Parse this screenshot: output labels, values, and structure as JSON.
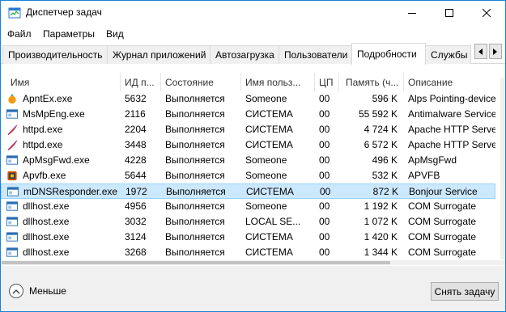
{
  "window": {
    "title": "Диспетчер задач"
  },
  "menu": [
    {
      "label": "Файл"
    },
    {
      "label": "Параметры"
    },
    {
      "label": "Вид"
    }
  ],
  "tabs": [
    {
      "label": "Производительность"
    },
    {
      "label": "Журнал приложений"
    },
    {
      "label": "Автозагрузка"
    },
    {
      "label": "Пользователи"
    },
    {
      "label": "Подробности",
      "active": true
    },
    {
      "label": "Службы"
    }
  ],
  "columns": [
    "Имя",
    "ИД п...",
    "Состояние",
    "Имя польз...",
    "ЦП",
    "Память (ч...",
    "Описание"
  ],
  "rows": [
    {
      "name": "ApntEx.exe",
      "pid": "5632",
      "status": "Выполняется",
      "user": "Someone",
      "cpu": "00",
      "memory": "596 K",
      "description": "Alps Pointing-device",
      "icon": "alps-icon"
    },
    {
      "name": "MsMpEng.exe",
      "pid": "2116",
      "status": "Выполняется",
      "user": "СИСТЕМА",
      "cpu": "00",
      "memory": "55 592 K",
      "description": "Antimalware Service",
      "icon": "service-window-icon"
    },
    {
      "name": "httpd.exe",
      "pid": "2204",
      "status": "Выполняется",
      "user": "СИСТЕМА",
      "cpu": "00",
      "memory": "4 724 K",
      "description": "Apache HTTP Serve",
      "icon": "apache-feather-icon"
    },
    {
      "name": "httpd.exe",
      "pid": "3448",
      "status": "Выполняется",
      "user": "СИСТЕМА",
      "cpu": "00",
      "memory": "6 572 K",
      "description": "Apache HTTP Serve",
      "icon": "apache-feather-icon"
    },
    {
      "name": "ApMsgFwd.exe",
      "pid": "4228",
      "status": "Выполняется",
      "user": "Someone",
      "cpu": "00",
      "memory": "496 K",
      "description": "ApMsgFwd",
      "icon": "service-window-icon"
    },
    {
      "name": "Apvfb.exe",
      "pid": "5644",
      "status": "Выполняется",
      "user": "Someone",
      "cpu": "00",
      "memory": "532 K",
      "description": "APVFB",
      "icon": "apvfb-icon"
    },
    {
      "name": "mDNSResponder.exe",
      "pid": "1972",
      "status": "Выполняется",
      "user": "СИСТЕМА",
      "cpu": "00",
      "memory": "872 K",
      "description": "Bonjour Service",
      "icon": "service-window-icon",
      "selected": true
    },
    {
      "name": "dllhost.exe",
      "pid": "4956",
      "status": "Выполняется",
      "user": "Someone",
      "cpu": "00",
      "memory": "1 192 K",
      "description": "COM Surrogate",
      "icon": "service-window-icon"
    },
    {
      "name": "dllhost.exe",
      "pid": "3032",
      "status": "Выполняется",
      "user": "LOCAL SE...",
      "cpu": "00",
      "memory": "1 072 K",
      "description": "COM Surrogate",
      "icon": "service-window-icon"
    },
    {
      "name": "dllhost.exe",
      "pid": "3124",
      "status": "Выполняется",
      "user": "СИСТЕМА",
      "cpu": "00",
      "memory": "1 420 K",
      "description": "COM Surrogate",
      "icon": "service-window-icon"
    },
    {
      "name": "dllhost.exe",
      "pid": "3268",
      "status": "Выполняется",
      "user": "СИСТЕМА",
      "cpu": "00",
      "memory": "1 344 K",
      "description": "COM Surrogate",
      "icon": "service-window-icon"
    }
  ],
  "footer": {
    "less_label": "Меньше",
    "end_task_label": "Снять задачу"
  }
}
